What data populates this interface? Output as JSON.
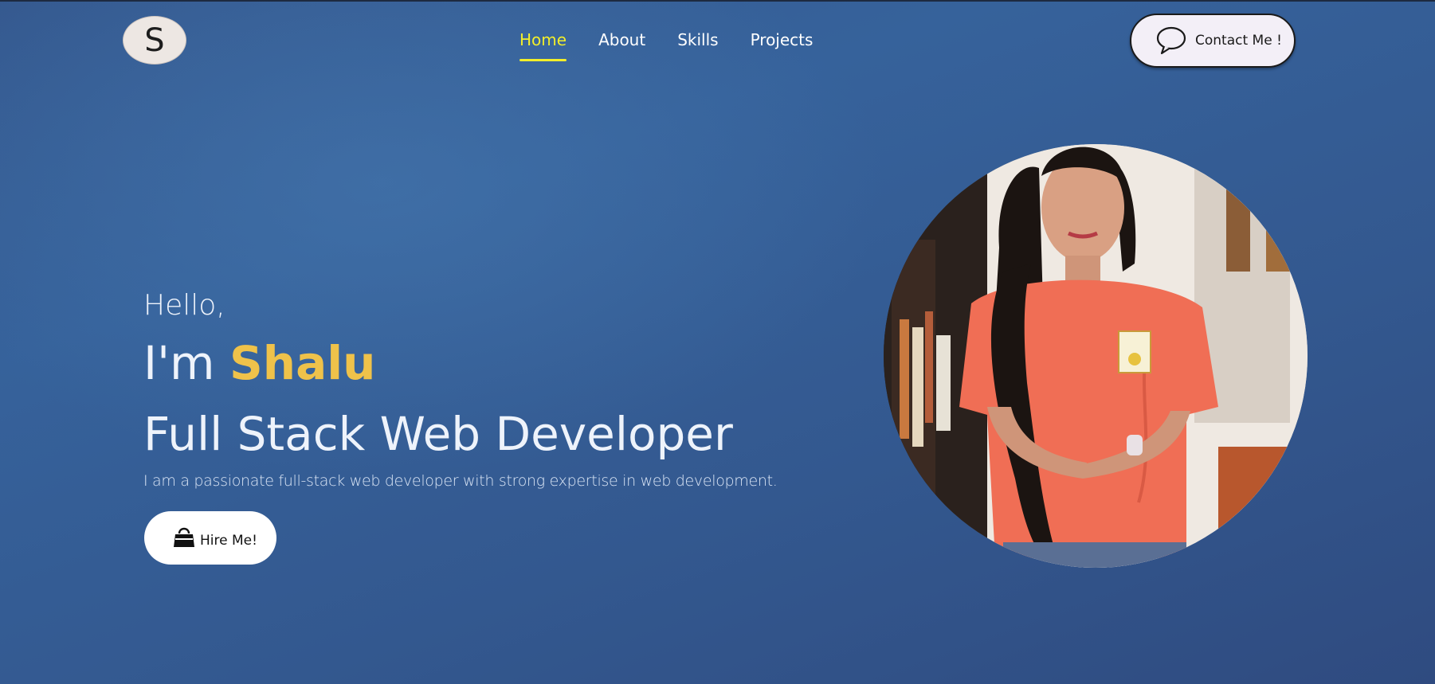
{
  "logo": {
    "letter": "S"
  },
  "nav": {
    "items": [
      {
        "label": "Home",
        "active": true
      },
      {
        "label": "About",
        "active": false
      },
      {
        "label": "Skills",
        "active": false
      },
      {
        "label": "Projects",
        "active": false
      }
    ],
    "active_color": "#f2ee2a"
  },
  "contact": {
    "label": "Contact Me !",
    "icon": "speech-bubble-icon"
  },
  "hero": {
    "greeting": "Hello,",
    "im_prefix": "I'm",
    "name": "Shalu",
    "role": "Full Stack Web Developer",
    "tagline": "I am a passionate full-stack web developer with strong expertise in web development.",
    "hire_label": "Hire Me!",
    "hire_icon": "handbag-icon",
    "name_color": "#efc24a"
  },
  "profile": {
    "image": "profile-photo"
  }
}
